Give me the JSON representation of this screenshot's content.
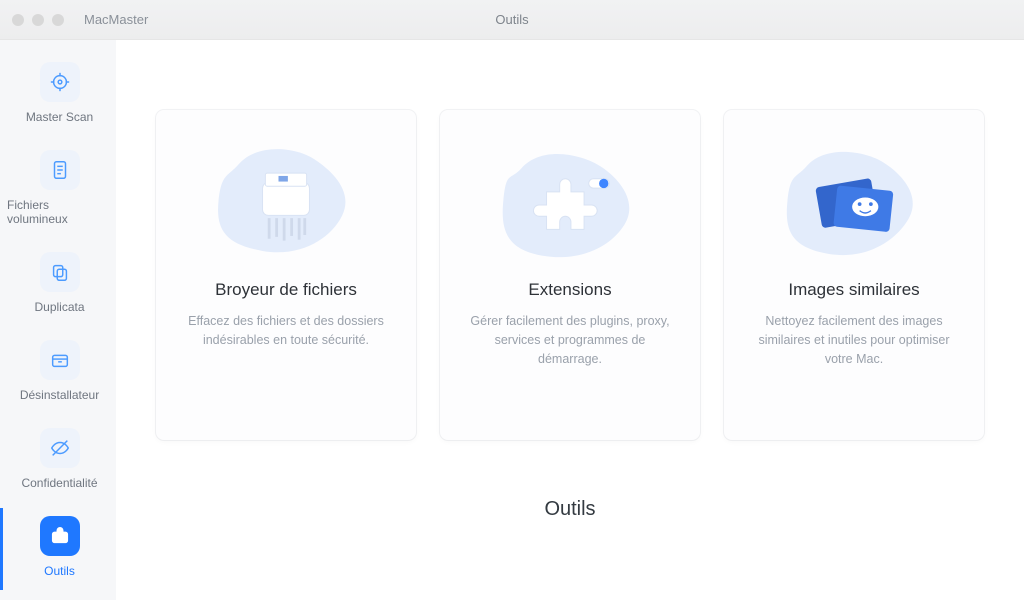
{
  "app_name": "MacMaster",
  "window_title": "Outils",
  "sidebar": {
    "items": [
      {
        "label": "Master Scan"
      },
      {
        "label": "Fichiers volumineux"
      },
      {
        "label": "Duplicata"
      },
      {
        "label": "Désinstallateur"
      },
      {
        "label": "Confidentialité"
      },
      {
        "label": "Outils"
      }
    ]
  },
  "main": {
    "cards": [
      {
        "title": "Broyeur de fichiers",
        "desc": "Effacez des fichiers et des dossiers indésirables en toute sécurité."
      },
      {
        "title": "Extensions",
        "desc": "Gérer facilement des plugins, proxy, services et programmes de démarrage."
      },
      {
        "title": "Images similaires",
        "desc": "Nettoyez facilement des images similaires et inutiles pour optimiser votre Mac."
      }
    ],
    "section_title": "Outils"
  }
}
